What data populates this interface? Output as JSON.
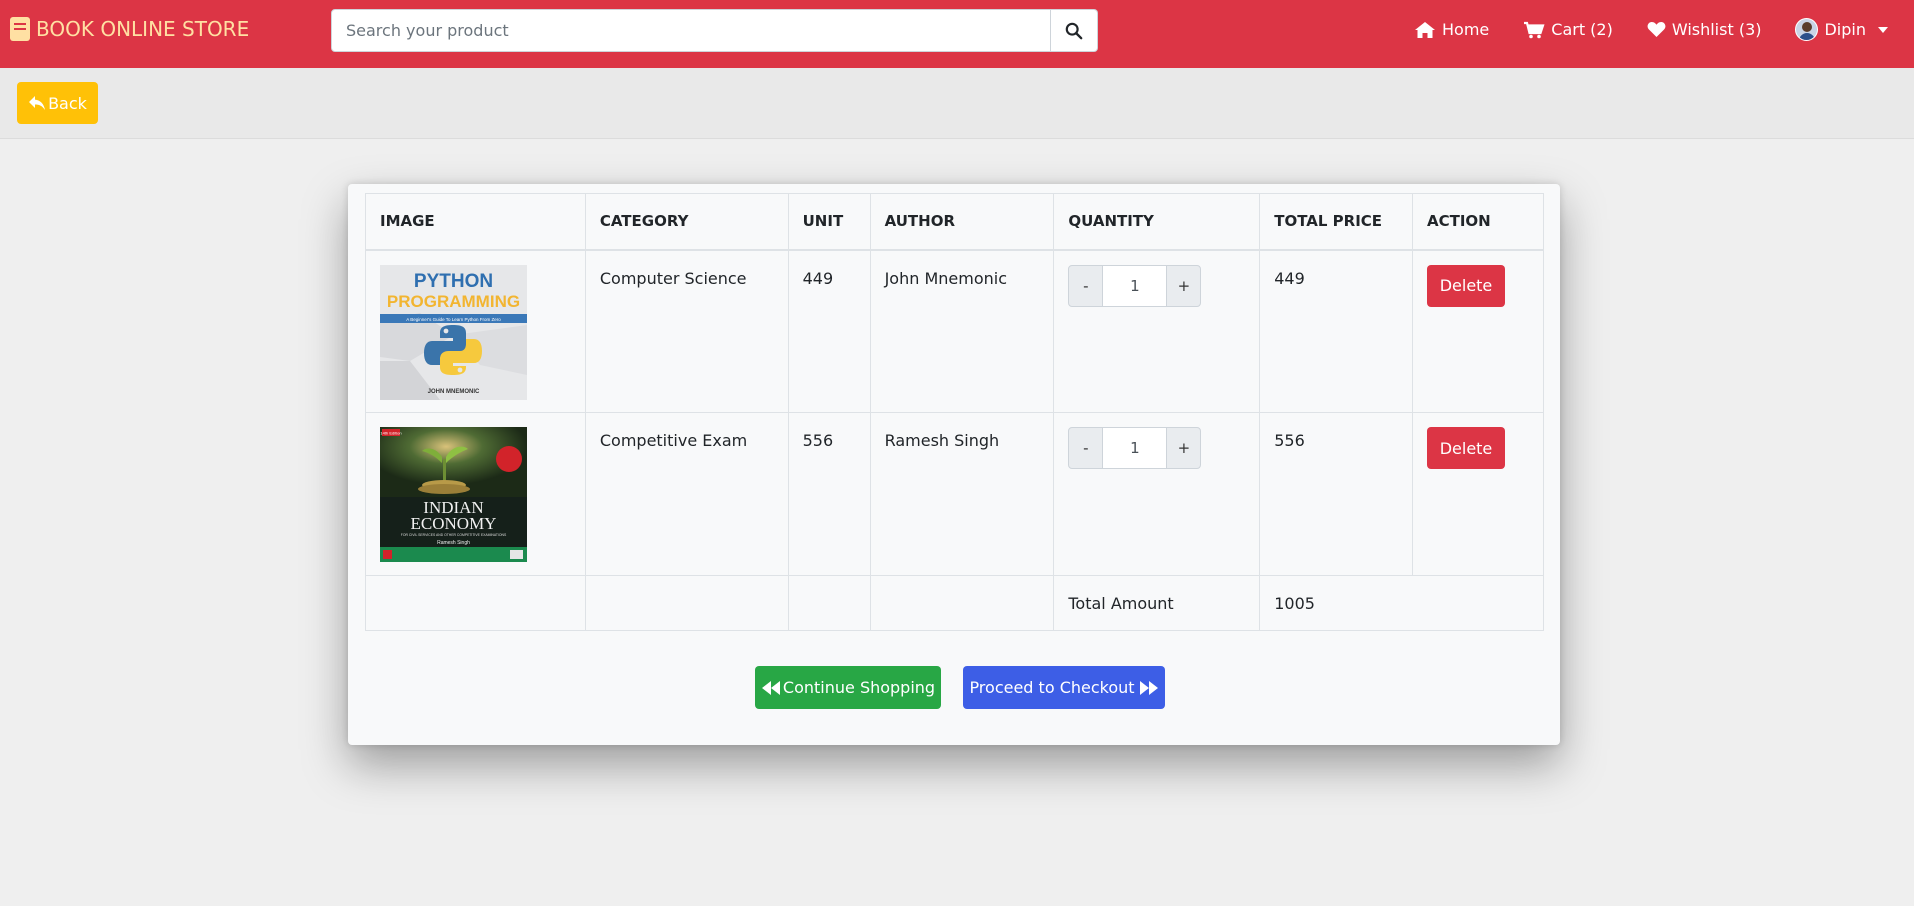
{
  "navbar": {
    "brand": "BOOK ONLINE STORE",
    "search_placeholder": "Search your product",
    "home": "Home",
    "cart": "Cart (2)",
    "wishlist": "Wishlist (3)",
    "user": "Dipin"
  },
  "back_label": "Back",
  "table": {
    "headers": [
      "IMAGE",
      "CATEGORY",
      "UNIT",
      "AUTHOR",
      "QUANTITY",
      "TOTAL PRICE",
      "ACTION"
    ],
    "rows": [
      {
        "category": "Computer Science",
        "unit": "449",
        "author": "John Mnemonic",
        "quantity": "1",
        "total": "449",
        "action": "Delete",
        "cover": {
          "title1": "PYTHON",
          "title2": "PROGRAMMING",
          "subtitle": "A Beginner's Guide To Learn Python From Zero",
          "author": "JOHN MNEMONIC"
        }
      },
      {
        "category": "Competitive Exam",
        "unit": "556",
        "author": "Ramesh Singh",
        "quantity": "1",
        "total": "556",
        "action": "Delete",
        "cover": {
          "edition": "14th Edition",
          "title1": "INDIAN",
          "title2": "ECONOMY",
          "subtitle": "FOR CIVIL SERVICES AND OTHER COMPETITIVE EXAMINATIONS",
          "author": "Ramesh Singh"
        }
      }
    ],
    "qty_minus": "-",
    "qty_plus": "+",
    "total_label": "Total Amount",
    "total_value": "1005"
  },
  "buttons": {
    "continue": "Continue Shopping",
    "checkout": "Proceed to Checkout"
  },
  "colors": {
    "navbar": "#dc3545",
    "back": "#ffc107",
    "delete": "#dc3545",
    "continue": "#28a745",
    "checkout": "#3d5ee6"
  }
}
